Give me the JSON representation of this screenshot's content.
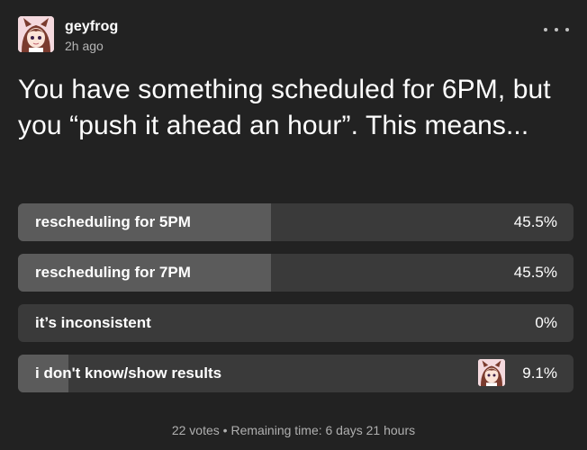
{
  "post": {
    "author": "geyfrog",
    "time": "2h ago",
    "avatar_icon": "anime-avatar-icon",
    "more_icon": "more-options-icon"
  },
  "poll": {
    "question": "You have something scheduled for 6PM, but you “push it ahead an hour”. This means...",
    "options": [
      {
        "label": "rescheduling for 5PM",
        "percent": "45.5%",
        "fill_fraction": 0.455
      },
      {
        "label": "rescheduling for 7PM",
        "percent": "45.5%",
        "fill_fraction": 0.455
      },
      {
        "label": "it’s inconsistent",
        "percent": "0%",
        "fill_fraction": 0
      },
      {
        "label": "i don't know/show results",
        "percent": "9.1%",
        "fill_fraction": 0.091,
        "voted": true
      }
    ],
    "footer": {
      "votes": "22 votes",
      "separator": "•",
      "remaining": "Remaining time: 6 days 21 hours"
    }
  },
  "colors": {
    "background": "#222222",
    "option_track": "#3a3a3a",
    "option_fill": "#5b5b5b",
    "muted_text": "#b5b5b5"
  }
}
